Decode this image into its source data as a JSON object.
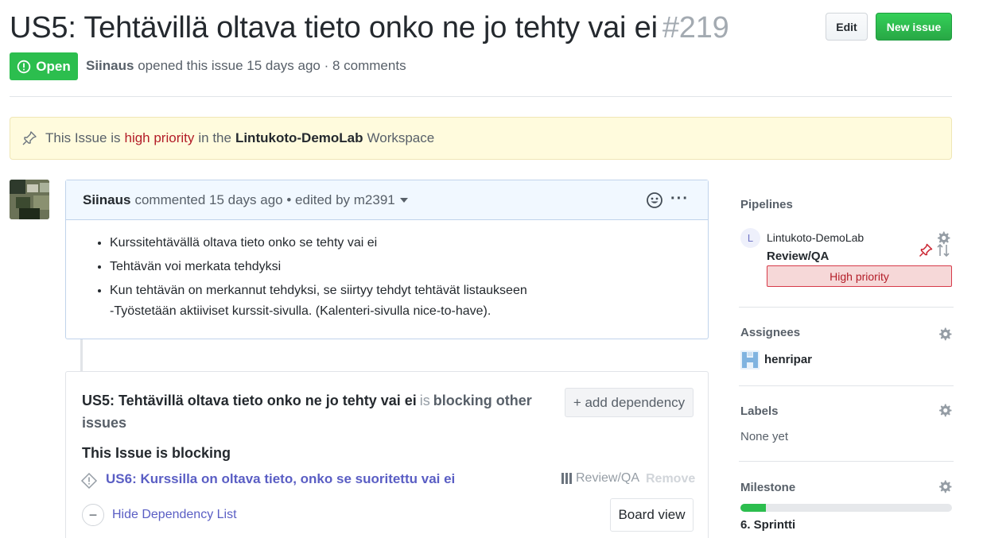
{
  "issue": {
    "title": "US5: Tehtävillä oltava tieto onko ne jo tehty vai ei",
    "number": "#219",
    "state": "Open",
    "author": "Siinaus",
    "opened_text": "opened this issue 15 days ago · 8 comments"
  },
  "header_buttons": {
    "edit": "Edit",
    "new_issue": "New issue"
  },
  "priority_banner": {
    "prefix": "This Issue is",
    "priority": "high priority",
    "middle": "in the",
    "workspace": "Lintukoto-DemoLab",
    "suffix": "Workspace"
  },
  "comment": {
    "author": "Siinaus",
    "meta": "commented 15 days ago • edited by m2391",
    "items": [
      "Kurssitehtävällä oltava tieto onko se tehty vai ei",
      "Tehtävän voi merkata tehdyksi",
      "Kun tehtävän on merkannut tehdyksi, se siirtyy tehdyt tehtävät listaukseen"
    ],
    "item_continuation": "-Työstetään aktiiviset kurssit-sivulla. (Kalenteri-sivulla nice-to-have)."
  },
  "dependencies": {
    "title": "US5: Tehtävillä oltava tieto onko ne jo tehty vai ei",
    "is": "is",
    "status": "blocking other issues",
    "add_button": "+ add dependency",
    "blocking_heading": "This Issue is blocking",
    "items": [
      {
        "title": "US6: Kurssilla on oltava tieto, onko se suoritettu vai ei",
        "pipeline": "Review/QA",
        "remove": "Remove"
      }
    ],
    "hide_list": "Hide Dependency List",
    "board_view": "Board view"
  },
  "sidebar": {
    "pipelines": {
      "heading": "Pipelines",
      "avatar_letter": "L",
      "workspace": "Lintukoto-DemoLab",
      "stage": "Review/QA",
      "priority": "High priority"
    },
    "assignees": {
      "heading": "Assignees",
      "users": [
        "henripar"
      ]
    },
    "labels": {
      "heading": "Labels",
      "value": "None yet"
    },
    "milestone": {
      "heading": "Milestone",
      "name": "6. Sprintti",
      "progress": 0.12
    }
  },
  "colors": {
    "open_green": "#2cbe4e",
    "priority_red": "#b31d28",
    "link_purple": "#5a5ec4"
  }
}
